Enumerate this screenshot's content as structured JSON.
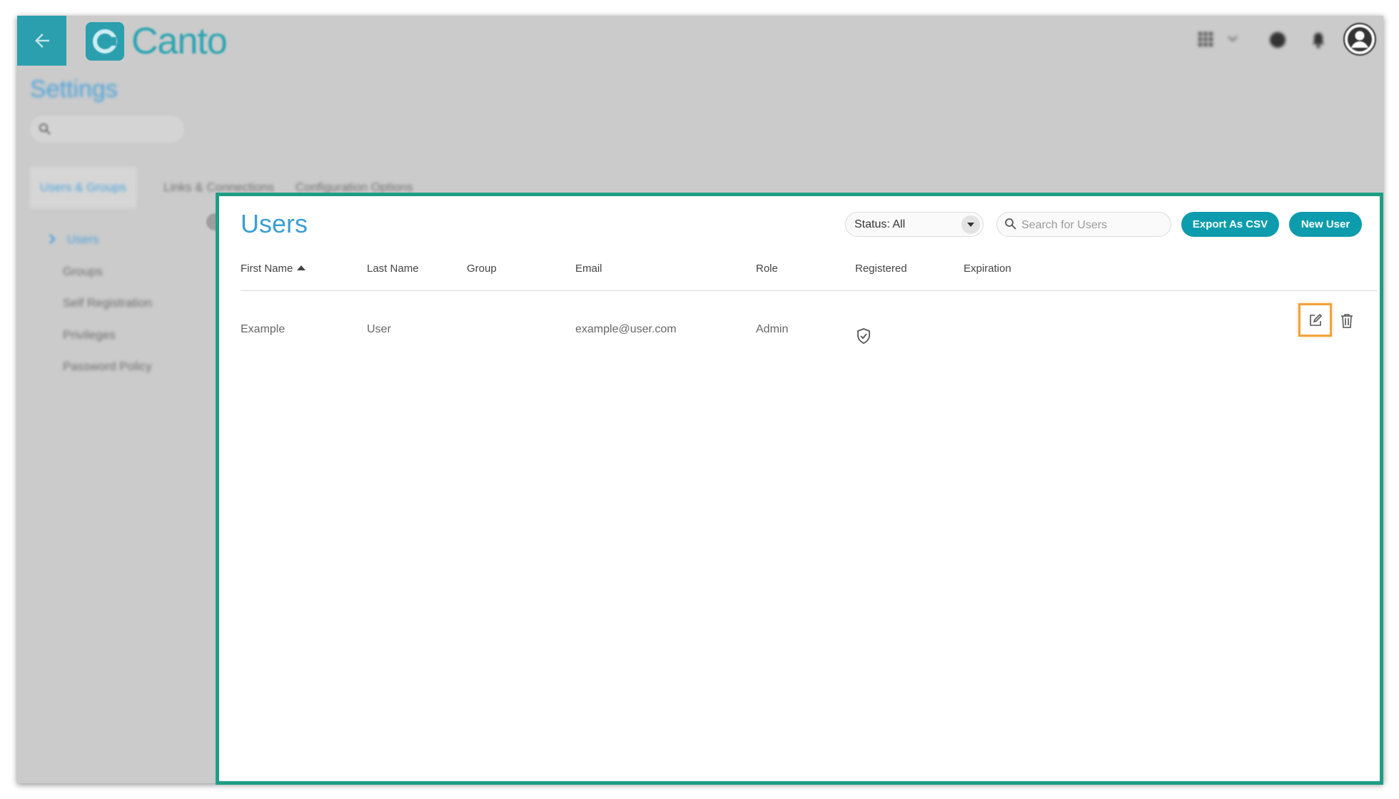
{
  "app": {
    "brand": "Canto",
    "page_title": "Settings",
    "tabs": [
      "Users & Groups",
      "Links & Connections",
      "Configuration Options"
    ],
    "sidebar": [
      "Users",
      "Groups",
      "Self Registration",
      "Privileges",
      "Password Policy"
    ],
    "top_icons": [
      "apps-grid-icon",
      "chevron-down-icon",
      "help-icon",
      "bell-icon",
      "account-avatar-icon"
    ]
  },
  "users_panel": {
    "title": "Users",
    "status_filter": "Status: All",
    "search_placeholder": "Search for Users",
    "export_label": "Export As CSV",
    "new_user_label": "New User",
    "columns": [
      "First Name",
      "Last Name",
      "Group",
      "Email",
      "Role",
      "Registered",
      "Expiration"
    ],
    "sort_column": "First Name",
    "sort_direction": "ascending",
    "rows": [
      {
        "first_name": "Example",
        "last_name": "User",
        "group": "",
        "email": "example@user.com",
        "role": "Admin",
        "registered_icon": "shield-check-icon",
        "expiration": ""
      }
    ]
  },
  "colors": {
    "accent": "#0c9cad",
    "title_blue": "#3a9fd3",
    "highlight_green": "#1e9e84",
    "highlight_orange": "#f2a33a"
  }
}
